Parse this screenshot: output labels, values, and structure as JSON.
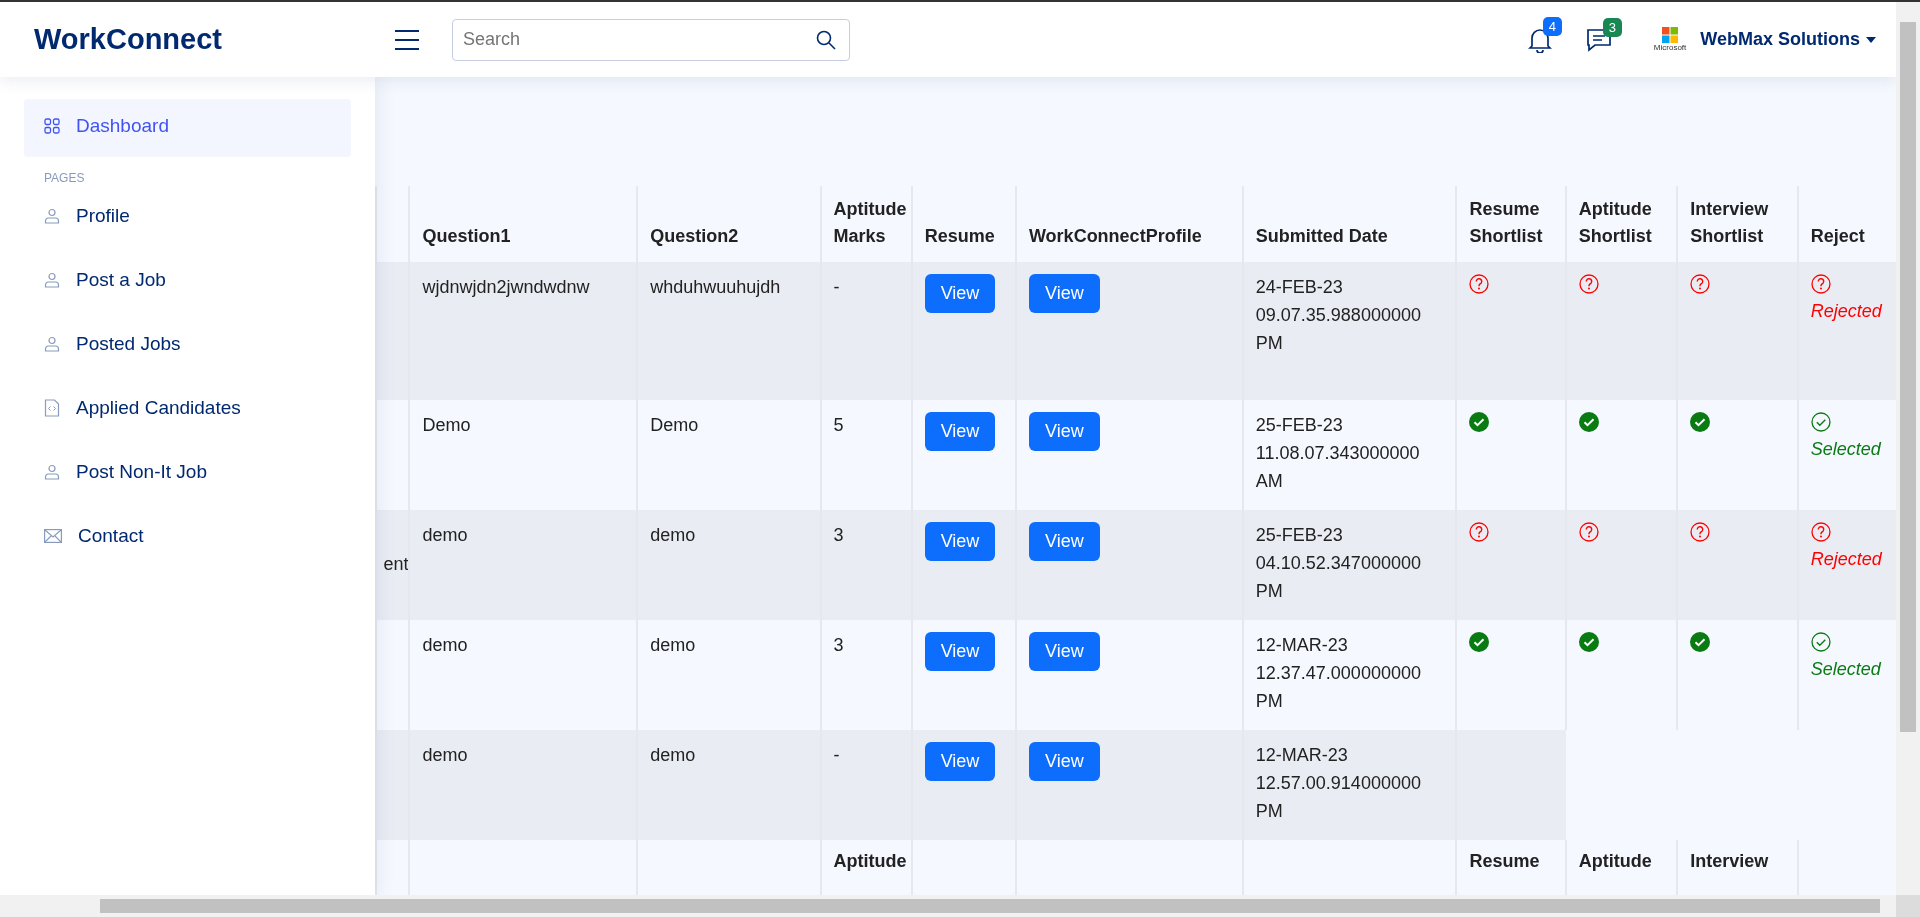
{
  "header": {
    "logo": "WorkConnect",
    "search": {
      "placeholder": "Search"
    },
    "notifications": {
      "count": "4"
    },
    "messages": {
      "count": "3"
    },
    "company": {
      "logo_caption": "Microsoft",
      "name": "WebMax Solutions"
    }
  },
  "sidebar": {
    "items": [
      {
        "label": "Dashboard",
        "kind": "grid",
        "selected": true
      }
    ],
    "section": "PAGES",
    "pages": [
      {
        "label": "Profile",
        "kind": "person",
        "selected": false
      },
      {
        "label": "Post a Job",
        "kind": "person",
        "selected": false
      },
      {
        "label": "Posted Jobs",
        "kind": "person",
        "selected": false
      },
      {
        "label": "Applied Candidates",
        "kind": "file",
        "selected": false
      },
      {
        "label": "Post Non-It Job",
        "kind": "person",
        "selected": false
      },
      {
        "label": "Contact",
        "kind": "mail",
        "selected": false
      }
    ]
  },
  "table": {
    "columns": [
      "",
      "Question1",
      "Question2",
      "Aptitude Marks",
      "Resume",
      "WorkConnectProfile",
      "Submitted Date",
      "Resume Shortlist",
      "Aptitude Shortlist",
      "Interview Shortlist",
      "Reject"
    ],
    "rows": [
      {
        "column_1": "",
        "question1": "wjdnwjdn2jwndwdnw",
        "question2": "whduhwuuhujdh",
        "aptitude_marks": "-",
        "resume": "View",
        "profile": "View",
        "submitted": "24-FEB-23 09.07.35.988000000 PM",
        "shortlists": [
          {
            "kind": "pending"
          },
          {
            "kind": "pending"
          },
          {
            "kind": "pending"
          }
        ],
        "reject": {
          "kind": "rejected",
          "label": "Rejected"
        }
      },
      {
        "column_1": "",
        "question1": "Demo",
        "question2": "Demo",
        "aptitude_marks": "5",
        "resume": "View",
        "profile": "View",
        "submitted": "25-FEB-23 11.08.07.343000000 AM",
        "shortlists": [
          {
            "kind": "done"
          },
          {
            "kind": "done"
          },
          {
            "kind": "done"
          }
        ],
        "reject": {
          "kind": "selected",
          "label": "Selected"
        }
      },
      {
        "column_1": "ent",
        "question1": "demo",
        "question2": "demo",
        "aptitude_marks": "3",
        "resume": "View",
        "profile": "View",
        "submitted": "25-FEB-23 04.10.52.347000000 PM",
        "shortlists": [
          {
            "kind": "pending"
          },
          {
            "kind": "pending"
          },
          {
            "kind": "pending"
          }
        ],
        "reject": {
          "kind": "rejected",
          "label": "Rejected"
        }
      },
      {
        "column_1": "",
        "question1": "demo",
        "question2": "demo",
        "aptitude_marks": "3",
        "resume": "View",
        "profile": "View",
        "submitted": "12-MAR-23 12.37.47.000000000 PM",
        "shortlists": [
          {
            "kind": "done"
          },
          {
            "kind": "done"
          },
          {
            "kind": "done"
          }
        ],
        "reject": {
          "kind": "selected",
          "label": "Selected"
        }
      },
      {
        "column_1": "",
        "question1": "demo",
        "question2": "demo",
        "aptitude_marks": "-",
        "resume": "View",
        "profile": "View",
        "submitted": "12-MAR-23 12.57.00.914000000 PM",
        "shortlists": [
          {
            "kind": "empty"
          }
        ]
      }
    ],
    "footer": [
      {
        "kind": "blank"
      },
      {
        "kind": "blank"
      },
      {
        "kind": "blank"
      },
      {
        "kind": "label",
        "label": "Aptitude"
      },
      {
        "kind": "blank"
      },
      {
        "kind": "blank"
      },
      {
        "kind": "blank"
      },
      {
        "kind": "label",
        "label": "Resume"
      },
      {
        "kind": "label",
        "label": "Aptitude"
      },
      {
        "kind": "label",
        "label": "Interview"
      },
      {
        "kind": "blank"
      }
    ]
  }
}
